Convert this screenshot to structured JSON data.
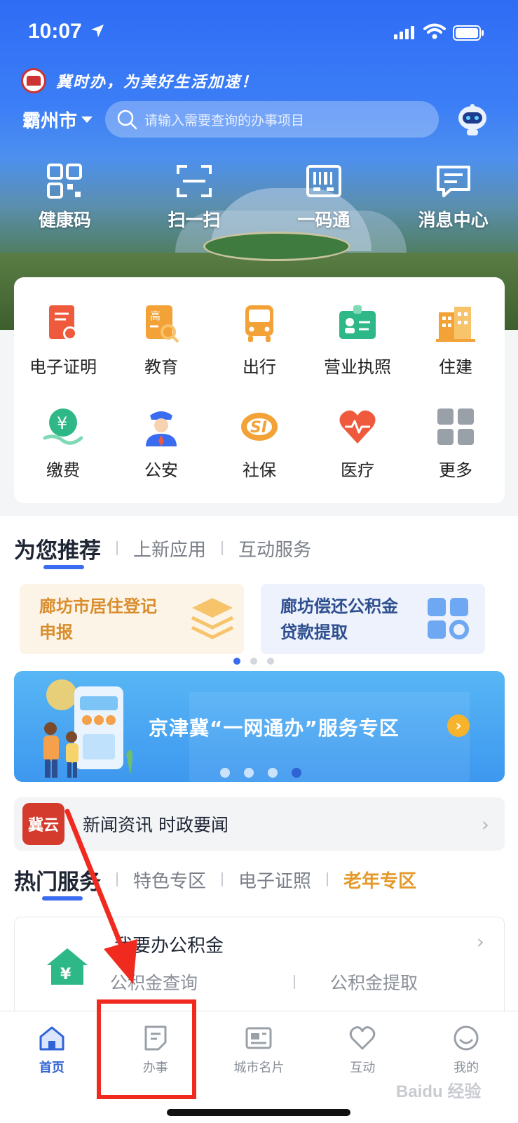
{
  "status_bar": {
    "time": "10:07"
  },
  "header": {
    "slogan": "冀时办，为美好生活加速！",
    "city": "霸州市",
    "search_placeholder": "请输入需要查询的办事项目"
  },
  "quick_actions": [
    {
      "label": "健康码",
      "icon": "qr-grid-icon"
    },
    {
      "label": "扫一扫",
      "icon": "scan-icon"
    },
    {
      "label": "一码通",
      "icon": "barcode-icon"
    },
    {
      "label": "消息中心",
      "icon": "message-icon"
    }
  ],
  "services": [
    {
      "label": "电子证明",
      "icon": "certificate-icon",
      "color": "#ef5a3c"
    },
    {
      "label": "教育",
      "icon": "education-icon",
      "color": "#f2a237"
    },
    {
      "label": "出行",
      "icon": "bus-icon",
      "color": "#f2a237"
    },
    {
      "label": "营业执照",
      "icon": "license-icon",
      "color": "#2fb887"
    },
    {
      "label": "住建",
      "icon": "building-icon",
      "color": "#f2a237"
    },
    {
      "label": "缴费",
      "icon": "payment-icon",
      "color": "#2fb887"
    },
    {
      "label": "公安",
      "icon": "police-icon",
      "color": "#3a6cf0"
    },
    {
      "label": "社保",
      "icon": "social-security-icon",
      "color": "#f2a237"
    },
    {
      "label": "医疗",
      "icon": "heart-icon",
      "color": "#ef5a3c"
    },
    {
      "label": "更多",
      "icon": "more-grid-icon",
      "color": "#9aa0a8"
    }
  ],
  "recommend": {
    "tabs": [
      "为您推荐",
      "上新应用",
      "互动服务"
    ],
    "cards": [
      {
        "line1": "廊坊市居住登记",
        "line2": "申报"
      },
      {
        "line1": "廊坊偿还公积金",
        "line2": "贷款提取"
      }
    ]
  },
  "banner": {
    "text": "京津冀“一网通办”服务专区",
    "arrow": "›"
  },
  "news": {
    "logo_text": "冀云",
    "text": "新闻资讯 时政要闻",
    "chevron": "›"
  },
  "hot": {
    "tabs": [
      "热门服务",
      "特色专区",
      "电子证照",
      "老年专区"
    ],
    "fund_card": {
      "title": "我要办公积金",
      "chevron": "›",
      "link1": "公积金查询",
      "link2": "公积金提取"
    }
  },
  "tabbar": [
    {
      "label": "首页",
      "icon": "home-icon",
      "active": true
    },
    {
      "label": "办事",
      "icon": "document-icon",
      "active": false
    },
    {
      "label": "城市名片",
      "icon": "city-card-icon",
      "active": false
    },
    {
      "label": "互动",
      "icon": "heart-outline-icon",
      "active": false
    },
    {
      "label": "我的",
      "icon": "smile-icon",
      "active": false
    }
  ],
  "watermark": "Baidu 经验",
  "colors": {
    "brand_blue": "#3a6cf0",
    "annotation_red": "#f02a1f",
    "accent_orange": "#e39a2a"
  }
}
